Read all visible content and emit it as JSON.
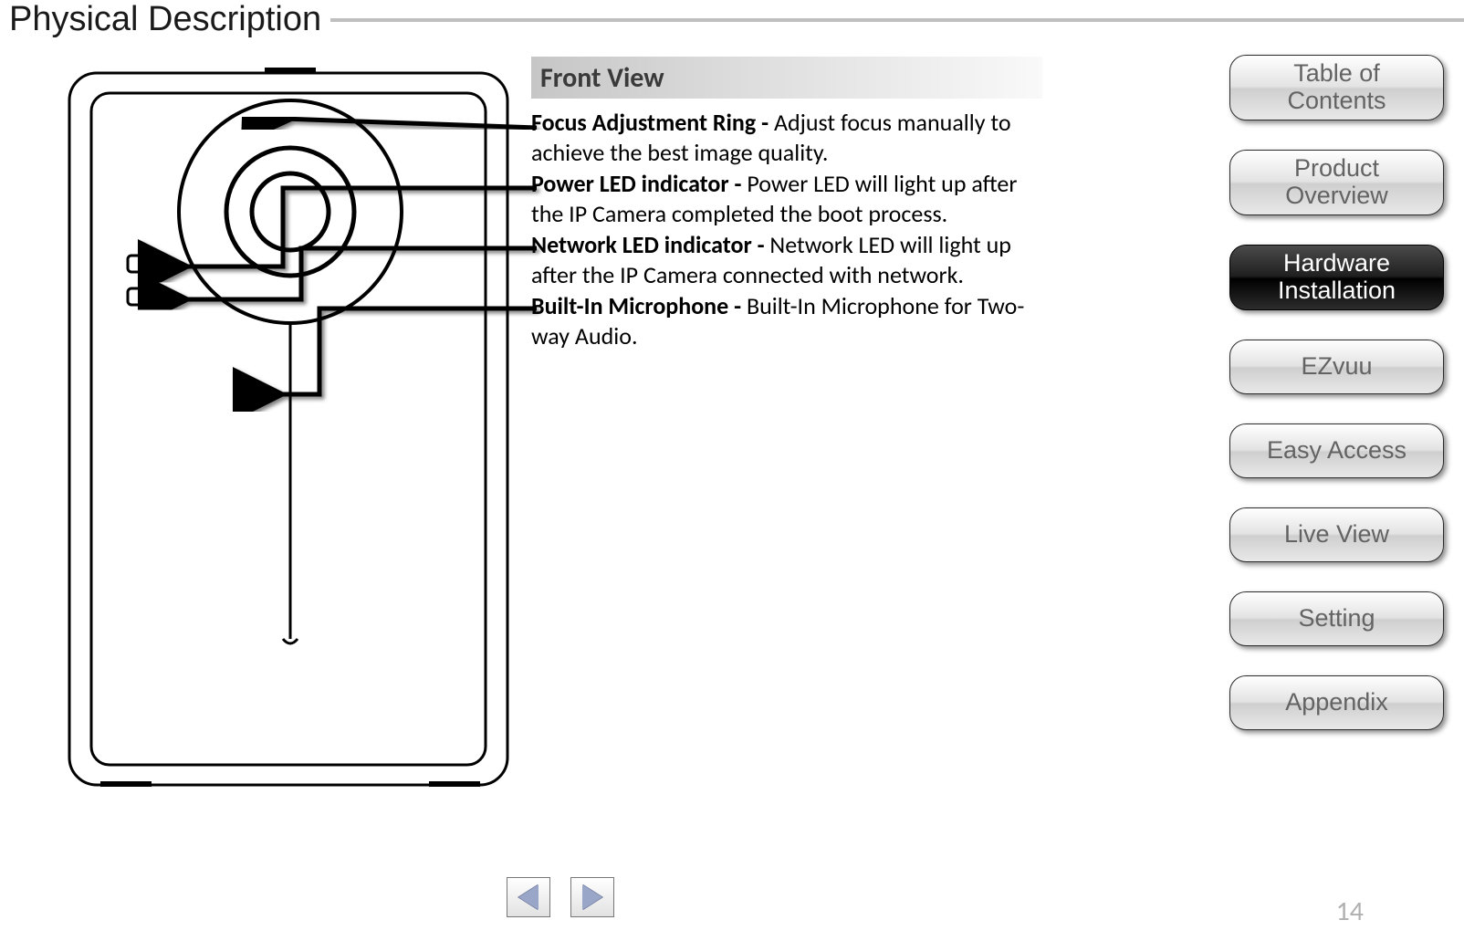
{
  "page": {
    "title": "Physical Description",
    "number": "14"
  },
  "section": {
    "header": "Front View"
  },
  "callouts": [
    {
      "label": "Focus Adjustment Ring - ",
      "text": "Adjust focus manually to achieve the best image quality."
    },
    {
      "label": "Power LED indicator - ",
      "text": "Power LED will light up after the IP Camera completed the boot process."
    },
    {
      "label": "Network LED indicator - ",
      "text": "Network LED will light up after the IP Camera connected with network."
    },
    {
      "label": "Built-In Microphone - ",
      "text": "Built-In Microphone for Two-way Audio."
    }
  ],
  "sidebar": [
    {
      "label": "Table of\nContents",
      "active": false,
      "single": false,
      "name": "nav-toc"
    },
    {
      "label": "Product\nOverview",
      "active": false,
      "single": false,
      "name": "nav-product-overview"
    },
    {
      "label": "Hardware\nInstallation",
      "active": true,
      "single": false,
      "name": "nav-hardware-installation"
    },
    {
      "label": "EZvuu",
      "active": false,
      "single": true,
      "name": "nav-ezvuu"
    },
    {
      "label": "Easy Access",
      "active": false,
      "single": true,
      "name": "nav-easy-access"
    },
    {
      "label": "Live View",
      "active": false,
      "single": true,
      "name": "nav-live-view"
    },
    {
      "label": "Setting",
      "active": false,
      "single": true,
      "name": "nav-setting"
    },
    {
      "label": "Appendix",
      "active": false,
      "single": true,
      "name": "nav-appendix"
    }
  ],
  "icons": {
    "prev": "triangle-left-icon",
    "next": "triangle-right-icon"
  }
}
